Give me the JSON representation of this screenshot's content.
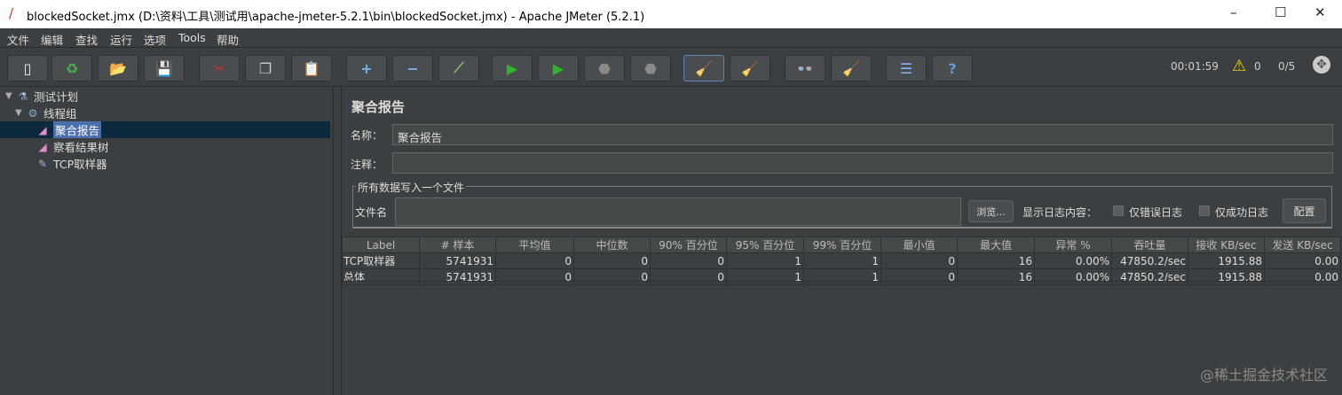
{
  "window": {
    "title": "blockedSocket.jmx (D:\\资料\\工具\\测试用\\apache-jmeter-5.2.1\\bin\\blockedSocket.jmx) - Apache JMeter (5.2.1)",
    "minimize": "–",
    "maximize": "☐",
    "close": "✕"
  },
  "menu": [
    "文件",
    "编辑",
    "查找",
    "运行",
    "选项",
    "Tools",
    "帮助"
  ],
  "toolbar": {
    "icons": [
      "new-icon",
      "templates-icon",
      "open-icon",
      "save-icon",
      "cut-icon",
      "copy-icon",
      "paste-icon",
      "expand-icon",
      "collapse-icon",
      "toggle-icon",
      "start-icon",
      "start-no-pause-icon",
      "stop-icon",
      "shutdown-icon",
      "clear-icon",
      "clear-all-icon",
      "search-icon",
      "reset-search-icon",
      "function-helper-icon",
      "help-icon"
    ],
    "glyphs": [
      "▯",
      "♻",
      "📂",
      "💾",
      "✂",
      "❐",
      "📋",
      "+",
      "−",
      "⟋",
      "▶",
      "▶",
      "⬣",
      "⬣",
      "🧹",
      "🧹",
      "👓",
      "🧹",
      "☰",
      "?"
    ],
    "colors": [
      "#f0f0f0",
      "#4caf50",
      "#e0a030",
      "#ddd",
      "#d32f2f",
      "#ccc",
      "#d9a75a",
      "#6fb3f0",
      "#6fb3f0",
      "#8fbf6f",
      "#2db52d",
      "#2db52d",
      "#8a8a8a",
      "#8a8a8a",
      "#c9a36a",
      "#c9a36a",
      "#d09060",
      "#e8c020",
      "#8ab4f8",
      "#5aa0e0"
    ]
  },
  "status": {
    "elapsed": "00:01:59",
    "warnings": "0",
    "threads": "0/5"
  },
  "tree": [
    {
      "label": "测试计划",
      "icon": "flask-icon",
      "glyph": "⚗",
      "level": 0,
      "expand": "▼"
    },
    {
      "label": "线程组",
      "icon": "gear-icon",
      "glyph": "⚙",
      "level": 1,
      "expand": "▼"
    },
    {
      "label": "聚合报告",
      "icon": "chart-icon",
      "glyph": "◢",
      "level": 2,
      "selected": true
    },
    {
      "label": "察看结果树",
      "icon": "chart-icon",
      "glyph": "◢",
      "level": 2
    },
    {
      "label": "TCP取样器",
      "icon": "pipette-icon",
      "glyph": "✎",
      "level": 2
    }
  ],
  "panel": {
    "title": "聚合报告",
    "name_label": "名称：",
    "name_value": "聚合报告",
    "comment_label": "注释：",
    "comment_value": "",
    "group_title": "所有数据写入一个文件",
    "filename_label": "文件名",
    "filename_value": "",
    "browse": "浏览...",
    "log_label": "显示日志内容：",
    "errors_only": "仅错误日志",
    "success_only": "仅成功日志",
    "configure": "配置"
  },
  "table": {
    "headers": [
      "Label",
      "# 样本",
      "平均值",
      "中位数",
      "90% 百分位",
      "95% 百分位",
      "99% 百分位",
      "最小值",
      "最大值",
      "异常 %",
      "吞吐量",
      "接收 KB/sec",
      "发送 KB/sec"
    ],
    "rows": [
      [
        "TCP取样器",
        "5741931",
        "0",
        "0",
        "0",
        "1",
        "1",
        "0",
        "16",
        "0.00%",
        "47850.2/sec",
        "1915.88",
        "0.00"
      ],
      [
        "总体",
        "5741931",
        "0",
        "0",
        "0",
        "1",
        "1",
        "0",
        "16",
        "0.00%",
        "47850.2/sec",
        "1915.88",
        "0.00"
      ]
    ]
  },
  "watermark": "@稀土掘金技术社区"
}
